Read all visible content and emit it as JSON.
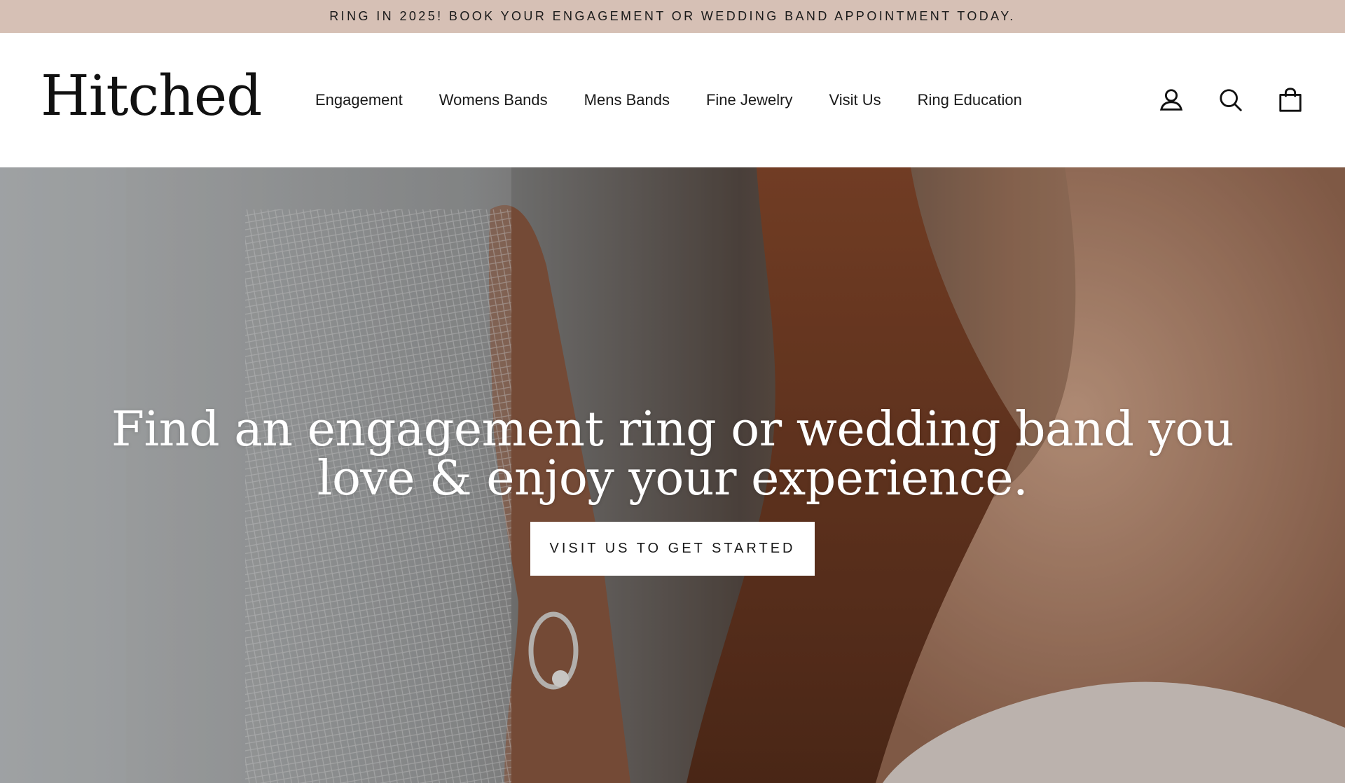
{
  "announcement": {
    "text": "RING IN 2025! BOOK YOUR ENGAGEMENT OR WEDDING BAND APPOINTMENT TODAY."
  },
  "header": {
    "logo": "Hitched",
    "nav": [
      {
        "label": "Engagement"
      },
      {
        "label": "Womens Bands"
      },
      {
        "label": "Mens Bands"
      },
      {
        "label": "Fine Jewelry"
      },
      {
        "label": "Visit Us"
      },
      {
        "label": "Ring Education"
      }
    ],
    "icons": [
      "account-icon",
      "search-icon",
      "cart-icon"
    ]
  },
  "hero": {
    "heading": "Find an engagement ring or wedding band you love & enjoy your experience.",
    "button_label": "VISIT US TO GET STARTED"
  },
  "colors": {
    "announcement_bg": "#d6c0b5",
    "header_bg": "#ffffff",
    "text": "#1a1a1a",
    "hero_text": "#ffffff",
    "button_bg": "#ffffff"
  }
}
